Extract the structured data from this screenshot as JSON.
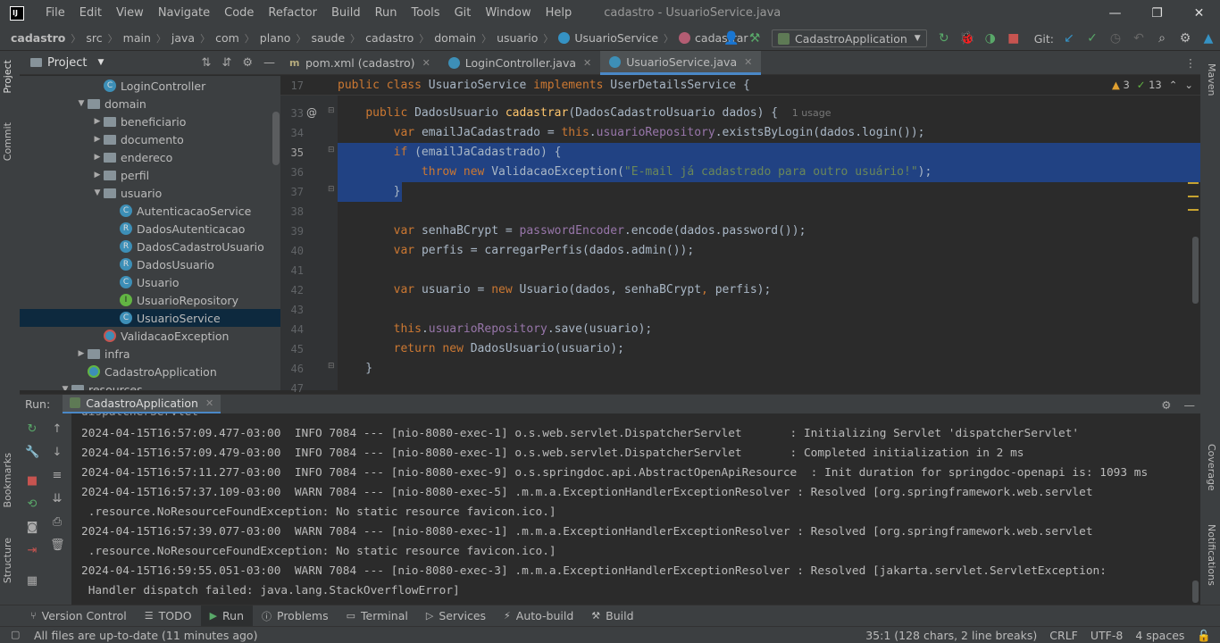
{
  "app": {
    "logo_text": "IJ",
    "window_title": "cadastro - UsuarioService.java",
    "menus": [
      "File",
      "Edit",
      "View",
      "Navigate",
      "Code",
      "Refactor",
      "Build",
      "Run",
      "Tools",
      "Git",
      "Window",
      "Help"
    ]
  },
  "window_controls": {
    "minimize": "—",
    "maximize": "❐",
    "close": "✕"
  },
  "breadcrumb": [
    "cadastro",
    "src",
    "main",
    "java",
    "com",
    "plano",
    "saude",
    "cadastro",
    "domain",
    "usuario",
    "UsuarioService",
    "cadastrar"
  ],
  "toolbar": {
    "run_config": "CadastroApplication",
    "git_label": "Git:"
  },
  "left_strip": {
    "project": "Project",
    "commit": "Commit",
    "bookmarks": "Bookmarks",
    "structure": "Structure"
  },
  "right_strip": {
    "maven": "Maven",
    "coverage": "Coverage",
    "notifications": "Notifications"
  },
  "project_panel": {
    "title": "Project",
    "tree": [
      {
        "label": "LoginController",
        "icon": "class",
        "indent": 3,
        "arrow": ""
      },
      {
        "label": "domain",
        "icon": "folder",
        "indent": 2,
        "arrow": "down"
      },
      {
        "label": "beneficiario",
        "icon": "folder",
        "indent": 3,
        "arrow": "right"
      },
      {
        "label": "documento",
        "icon": "folder",
        "indent": 3,
        "arrow": "right"
      },
      {
        "label": "endereco",
        "icon": "folder",
        "indent": 3,
        "arrow": "right"
      },
      {
        "label": "perfil",
        "icon": "folder",
        "indent": 3,
        "arrow": "right"
      },
      {
        "label": "usuario",
        "icon": "folder",
        "indent": 3,
        "arrow": "down"
      },
      {
        "label": "AutenticacaoService",
        "icon": "class",
        "indent": 4,
        "arrow": ""
      },
      {
        "label": "DadosAutenticacao",
        "icon": "record",
        "indent": 4,
        "arrow": ""
      },
      {
        "label": "DadosCadastroUsuario",
        "icon": "record",
        "indent": 4,
        "arrow": ""
      },
      {
        "label": "DadosUsuario",
        "icon": "record",
        "indent": 4,
        "arrow": ""
      },
      {
        "label": "Usuario",
        "icon": "class",
        "indent": 4,
        "arrow": ""
      },
      {
        "label": "UsuarioRepository",
        "icon": "interface",
        "indent": 4,
        "arrow": ""
      },
      {
        "label": "UsuarioService",
        "icon": "class",
        "indent": 4,
        "arrow": "",
        "selected": true
      },
      {
        "label": "ValidacaoException",
        "icon": "exception",
        "indent": 3,
        "arrow": ""
      },
      {
        "label": "infra",
        "icon": "folder",
        "indent": 2,
        "arrow": "right"
      },
      {
        "label": "CadastroApplication",
        "icon": "app",
        "indent": 2,
        "arrow": ""
      },
      {
        "label": "resources",
        "icon": "folder",
        "indent": 1,
        "arrow": "down"
      }
    ]
  },
  "editor_tabs": [
    {
      "label": "pom.xml (cadastro)",
      "icon": "maven",
      "active": false
    },
    {
      "label": "LoginController.java",
      "icon": "class",
      "active": false
    },
    {
      "label": "UsuarioService.java",
      "icon": "class",
      "active": true
    }
  ],
  "inspections": {
    "warnings": "3",
    "ok": "13"
  },
  "editor": {
    "sticky_line_no": "17",
    "sticky_code": "public class UsuarioService implements UserDetailsService {",
    "line_numbers": [
      "33",
      "34",
      "35",
      "36",
      "37",
      "38",
      "39",
      "40",
      "41",
      "42",
      "43",
      "44",
      "45",
      "46",
      "47"
    ],
    "usage_hint": "1 usage",
    "lines": {
      "l33": [
        "    ",
        "public ",
        "DadosUsuario ",
        "cadastrar",
        "(DadosCadastroUsuario dados) {"
      ],
      "l34": [
        "        ",
        "var ",
        "emailJaCadastrado = ",
        "this",
        ".",
        "usuarioRepository",
        ".existsByLogin(dados.login());"
      ],
      "l35": [
        "        ",
        "if ",
        "(emailJaCadastrado) {"
      ],
      "l36": [
        "            ",
        "throw new ",
        "ValidacaoException(",
        "\"E-mail já cadastrado para outro usuário!\"",
        ");"
      ],
      "l37": [
        "        }"
      ],
      "l39": [
        "        ",
        "var ",
        "senhaBCrypt = ",
        "passwordEncoder",
        ".encode(dados.password());"
      ],
      "l40": [
        "        ",
        "var ",
        "perfis = carregarPerfis(dados.admin());"
      ],
      "l42": [
        "        ",
        "var ",
        "usuario = ",
        "new ",
        "Usuario(dados, senhaBCrypt",
        ", ",
        "perfis);"
      ],
      "l44": [
        "        ",
        "this",
        ".",
        "usuarioRepository",
        ".save(usuario);"
      ],
      "l45": [
        "        ",
        "return new ",
        "DadosUsuario(usuario);"
      ],
      "l46": [
        "    }"
      ]
    }
  },
  "run_panel": {
    "label": "Run:",
    "tab": "CadastroApplication",
    "console": [
      "2024-04-15T16:57:09.477-03:00  INFO 7084 --- [nio-8080-exec-1] o.s.web.servlet.DispatcherServlet       : Initializing Servlet 'dispatcherServlet'",
      "2024-04-15T16:57:09.479-03:00  INFO 7084 --- [nio-8080-exec-1] o.s.web.servlet.DispatcherServlet       : Completed initialization in 2 ms",
      "2024-04-15T16:57:11.277-03:00  INFO 7084 --- [nio-8080-exec-9] o.s.springdoc.api.AbstractOpenApiResource  : Init duration for springdoc-openapi is: 1093 ms",
      "2024-04-15T16:57:37.109-03:00  WARN 7084 --- [nio-8080-exec-5] .m.m.a.ExceptionHandlerExceptionResolver : Resolved [org.springframework.web.servlet",
      " .resource.NoResourceFoundException: No static resource favicon.ico.]",
      "2024-04-15T16:57:39.077-03:00  WARN 7084 --- [nio-8080-exec-1] .m.m.a.ExceptionHandlerExceptionResolver : Resolved [org.springframework.web.servlet",
      " .resource.NoResourceFoundException: No static resource favicon.ico.]",
      "2024-04-15T16:59:55.051-03:00  WARN 7084 --- [nio-8080-exec-3] .m.m.a.ExceptionHandlerExceptionResolver : Resolved [jakarta.servlet.ServletException:",
      " Handler dispatch failed: java.lang.StackOverflowError]"
    ],
    "console_partial_top": "dispatcherServlet"
  },
  "bottom_tools": [
    "Version Control",
    "TODO",
    "Run",
    "Problems",
    "Terminal",
    "Services",
    "Auto-build",
    "Build"
  ],
  "status": {
    "message": "All files are up-to-date (11 minutes ago)",
    "position": "35:1 (128 chars, 2 line breaks)",
    "line_sep": "CRLF",
    "encoding": "UTF-8",
    "indent": "4 spaces"
  },
  "colors": {
    "background": "#2b2b2b",
    "panel": "#3c3f41",
    "selection": "#214283",
    "keyword": "#cc7832",
    "string": "#6a8759",
    "field": "#9876aa",
    "method_decl": "#ffc66d"
  }
}
